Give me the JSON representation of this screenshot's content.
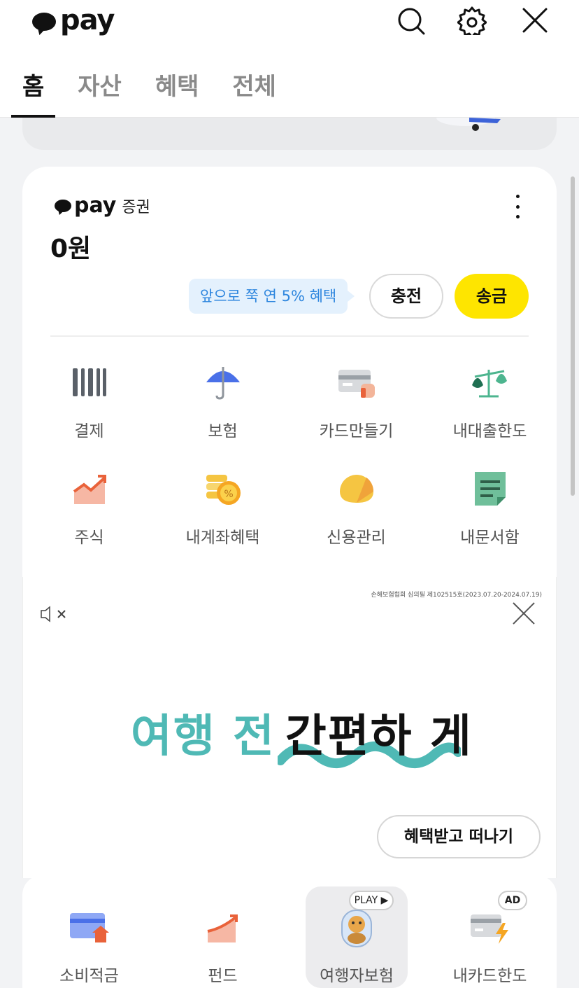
{
  "header": {
    "logo_text": "pay",
    "icons": [
      "search-icon",
      "gear-icon",
      "close-icon"
    ],
    "tabs": [
      {
        "label": "홈",
        "active": true
      },
      {
        "label": "자산",
        "active": false
      },
      {
        "label": "혜택",
        "active": false
      },
      {
        "label": "전체",
        "active": false
      }
    ]
  },
  "securities": {
    "logo_text": "pay",
    "logo_sub": "증권",
    "balance": "0원",
    "tooltip": "앞으로 쭉 연 5% 혜택",
    "charge_label": "충전",
    "send_label": "송금"
  },
  "services": [
    {
      "label": "결제",
      "icon": "barcode-icon"
    },
    {
      "label": "보험",
      "icon": "umbrella-icon"
    },
    {
      "label": "카드만들기",
      "icon": "card-icon"
    },
    {
      "label": "내대출한도",
      "icon": "scale-icon"
    },
    {
      "label": "주식",
      "icon": "stock-chart-icon"
    },
    {
      "label": "내계좌혜택",
      "icon": "coins-icon"
    },
    {
      "label": "신용관리",
      "icon": "credit-gauge-icon"
    },
    {
      "label": "내문서함",
      "icon": "document-icon"
    }
  ],
  "ad": {
    "notice": "손해보험협회 심의필 제102515호(2023.07.20-2024.07.19)",
    "headline_teal": "여행 전",
    "headline_dark": "간편하 게",
    "button_label": "혜택받고 떠나기"
  },
  "bottom_items": [
    {
      "label": "소비적금",
      "icon": "savings-card-icon"
    },
    {
      "label": "펀드",
      "icon": "fund-chart-icon"
    },
    {
      "label": "여행자보험",
      "icon": "travel-insurance-icon",
      "badge": "PLAY ▶"
    },
    {
      "label": "내카드한도",
      "icon": "card-limit-icon",
      "badge": "AD"
    }
  ],
  "colors": {
    "kakao_yellow": "#fee500",
    "tooltip_blue": "#2e86de",
    "teal": "#4fb9b5"
  }
}
